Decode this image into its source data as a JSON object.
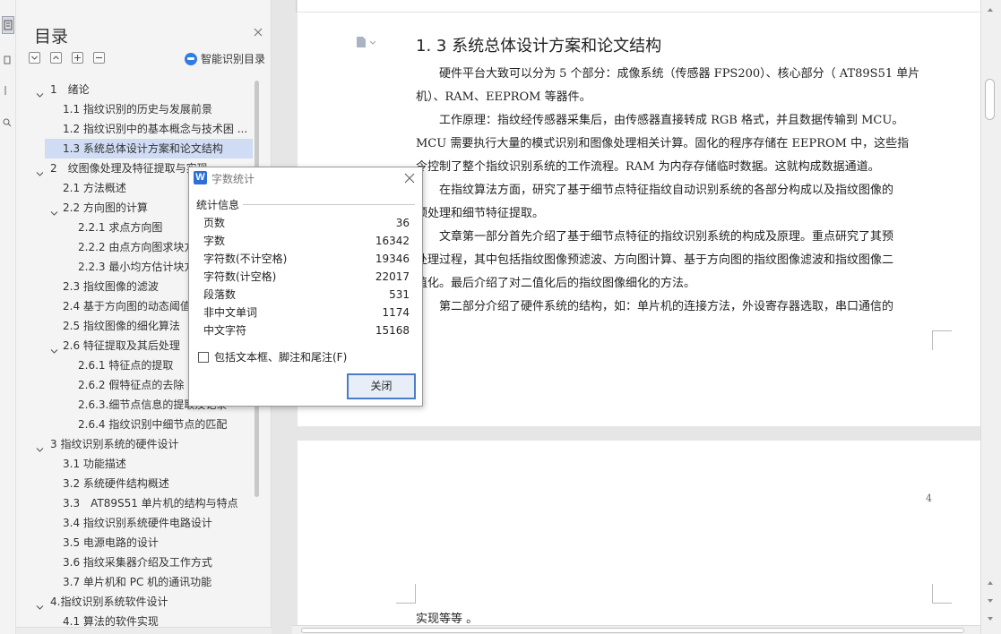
{
  "toc_panel": {
    "title": "目录",
    "smart_label": "智能识别目录",
    "items": [
      {
        "label": "1　绪论",
        "level": 1,
        "expanded": true
      },
      {
        "label": "1.1 指纹识别的历史与发展前景",
        "level": 2
      },
      {
        "label": "1.2 指纹识别中的基本概念与技术困 ...",
        "level": 2
      },
      {
        "label": "1.3 系统总体设计方案和论文结构",
        "level": 2,
        "selected": true
      },
      {
        "label": "2　纹图像处理及特征提取与实现",
        "level": 1,
        "expanded": true
      },
      {
        "label": "2.1 方法概述",
        "level": 2
      },
      {
        "label": "2.2 方向图的计算",
        "level": 2,
        "expanded": true
      },
      {
        "label": "2.2.1 求点方向图",
        "level": 3
      },
      {
        "label": "2.2.2 由点方向图求块方向图",
        "level": 3
      },
      {
        "label": "2.2.3 最小均方估计块方向图",
        "level": 3
      },
      {
        "label": "2.3 指纹图像的滤波",
        "level": 2
      },
      {
        "label": "2.4 基于方向图的动态阈值二值化",
        "level": 2
      },
      {
        "label": "2.5 指纹图像的细化算法",
        "level": 2
      },
      {
        "label": "2.6 特征提取及其后处理",
        "level": 2,
        "expanded": true
      },
      {
        "label": "2.6.1 特征点的提取",
        "level": 3
      },
      {
        "label": "2.6.2 假特征点的去除",
        "level": 3
      },
      {
        "label": "2.6.3.细节点信息的提取及记录",
        "level": 3
      },
      {
        "label": "2.6.4 指纹识别中细节点的匹配",
        "level": 3
      },
      {
        "label": "3 指纹识别系统的硬件设计",
        "level": 1,
        "expanded": true
      },
      {
        "label": "3.1 功能描述",
        "level": 2
      },
      {
        "label": "3.2 系统硬件结构概述",
        "level": 2
      },
      {
        "label": "3.3　AT89S51 单片机的结构与特点",
        "level": 2
      },
      {
        "label": "3.4 指纹识别系统硬件电路设计",
        "level": 2
      },
      {
        "label": "3.5 电源电路的设计",
        "level": 2
      },
      {
        "label": "3.6 指纹采集器介绍及工作方式",
        "level": 2
      },
      {
        "label": "3.7 单片机和 PC 机的通讯功能",
        "level": 2
      },
      {
        "label": "4.指纹识别系统软件设计",
        "level": 1,
        "expanded": true
      },
      {
        "label": "4.1 算法的软件实现",
        "level": 2
      }
    ]
  },
  "document": {
    "heading": "1. 3 系统总体设计方案和论文结构",
    "paragraphs": [
      {
        "lines": [
          "硬件平台大致可以分为 5 个部分：成像系统（传感器 FPS200）、核心部分（ AT89S51 单片",
          "机）、RAM、EEPROM 等器件。"
        ]
      },
      {
        "lines": [
          "工作原理：指纹经传感器采集后，由传感器直接转成 RGB 格式，并且数据传输到 MCU。",
          "MCU 需要执行大量的模式识别和图像处理相关计算。固化的程序存储在 EEPROM 中，这些指",
          "令控制了整个指纹识别系统的工作流程。RAM 为内存存储临时数据。这就构成数据通道。"
        ]
      },
      {
        "lines": [
          "在指纹算法方面，研究了基于细节点特征指纹自动识别系统的各部分构成以及指纹图像的",
          "预处理和细节特征提取。"
        ]
      },
      {
        "lines": [
          "文章第一部分首先介绍了基于细节点特征的指纹识别系统的构成及原理。重点研究了其预",
          "处理过程，其中包括指纹图像预滤波、方向图计算、基于方向图的指纹图像滤波和指纹图像二",
          "值化。最后介绍了对二值化后的指纹图像细化的方法。"
        ]
      },
      {
        "lines": [
          "第二部分介绍了硬件系统的结构，如：单片机的连接方法，外设寄存器选取，串口通信的"
        ]
      }
    ],
    "page_number": "4",
    "next_page_text": "实现等等 。"
  },
  "word_count_dialog": {
    "title": "字数统计",
    "group_label": "统计信息",
    "stats": [
      {
        "label": "页数",
        "value": "36"
      },
      {
        "label": "字数",
        "value": "16342"
      },
      {
        "label": "字符数(不计空格)",
        "value": "19346"
      },
      {
        "label": "字符数(计空格)",
        "value": "22017"
      },
      {
        "label": "段落数",
        "value": "531"
      },
      {
        "label": "非中文单词",
        "value": "1174"
      },
      {
        "label": "中文字符",
        "value": "15168"
      }
    ],
    "checkbox_label": "包括文本框、脚注和尾注(F)",
    "checkbox_checked": false,
    "close_button": "关闭"
  },
  "colors": {
    "selected_row": "#cfdcf3",
    "accent": "#2d6fd6",
    "button_border": "#4a7cc9"
  }
}
